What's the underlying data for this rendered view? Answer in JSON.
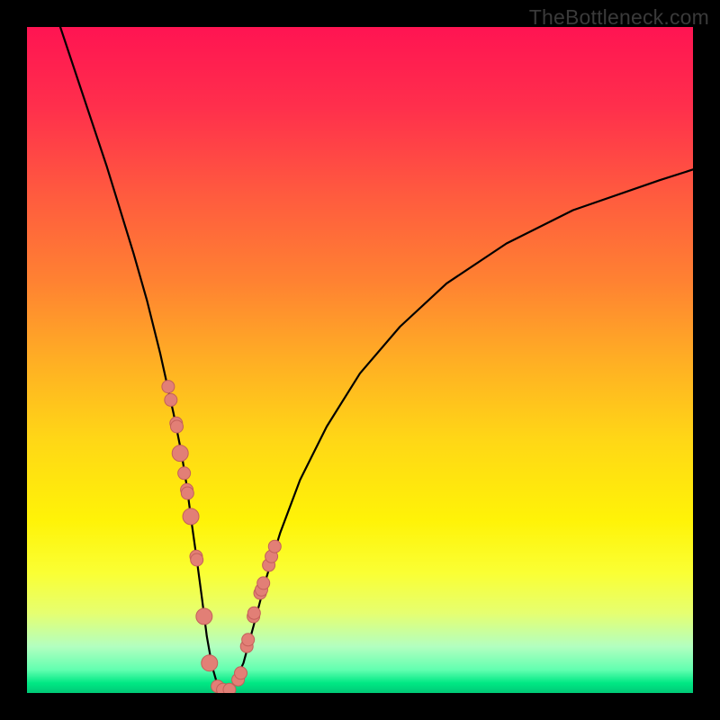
{
  "watermark": "TheBottleneck.com",
  "colors": {
    "frame": "#000000",
    "curve": "#000000",
    "points_fill": "#e27f76",
    "points_stroke": "#c4605a",
    "gradient_stops": [
      {
        "offset": 0.0,
        "color": "#ff1452"
      },
      {
        "offset": 0.12,
        "color": "#ff2f4c"
      },
      {
        "offset": 0.25,
        "color": "#ff5a3f"
      },
      {
        "offset": 0.38,
        "color": "#ff8132"
      },
      {
        "offset": 0.5,
        "color": "#ffae24"
      },
      {
        "offset": 0.62,
        "color": "#ffd716"
      },
      {
        "offset": 0.74,
        "color": "#fff307"
      },
      {
        "offset": 0.82,
        "color": "#faff34"
      },
      {
        "offset": 0.88,
        "color": "#e6ff70"
      },
      {
        "offset": 0.93,
        "color": "#b3ffc0"
      },
      {
        "offset": 0.965,
        "color": "#62ffb0"
      },
      {
        "offset": 0.985,
        "color": "#00e884"
      },
      {
        "offset": 1.0,
        "color": "#00c876"
      }
    ]
  },
  "chart_data": {
    "type": "line",
    "title": "",
    "xlabel": "",
    "ylabel": "",
    "xlim": [
      0,
      100
    ],
    "ylim": [
      0,
      100
    ],
    "series": [
      {
        "name": "bottleneck-curve",
        "x": [
          5,
          8,
          12,
          16,
          18,
          20,
          22,
          23.2,
          24,
          24.8,
          25.5,
          26.3,
          27,
          27.8,
          28.6,
          29.4,
          30,
          31,
          32.5,
          34,
          36,
          38,
          41,
          45,
          50,
          56,
          63,
          72,
          82,
          95,
          100
        ],
        "y": [
          100,
          91,
          79,
          66,
          59,
          51,
          42,
          36,
          31,
          25,
          20,
          14,
          8.5,
          4,
          1.2,
          0.4,
          0.4,
          1.2,
          4.5,
          10,
          17.5,
          24,
          32,
          40,
          48,
          55,
          61.5,
          67.5,
          72.5,
          77,
          78.6
        ]
      }
    ],
    "scatter_points": {
      "name": "calibration-points",
      "x": [
        21.2,
        21.6,
        22.4,
        22.5,
        23.0,
        23.6,
        24.0,
        24.1,
        24.6,
        25.4,
        25.5,
        26.6,
        27.4,
        28.6,
        29.4,
        30.4,
        31.7,
        32.1,
        33.0,
        33.2,
        34.0,
        34.1,
        35.0,
        35.2,
        35.5,
        36.3,
        36.7,
        37.2
      ],
      "y": [
        46.0,
        44.0,
        40.5,
        40.0,
        36.0,
        33.0,
        30.5,
        30.0,
        26.5,
        20.5,
        20.0,
        11.5,
        4.5,
        1.0,
        0.5,
        0.5,
        2.0,
        3.0,
        7.0,
        8.0,
        11.5,
        12.0,
        15.0,
        15.5,
        16.5,
        19.2,
        20.5,
        22.0
      ],
      "r": [
        7,
        7,
        7,
        7,
        9,
        7,
        7,
        7,
        9,
        7,
        7,
        9,
        9,
        7,
        7,
        7,
        7,
        7,
        7,
        7,
        7,
        7,
        7,
        7,
        7,
        7,
        7,
        7
      ]
    }
  }
}
